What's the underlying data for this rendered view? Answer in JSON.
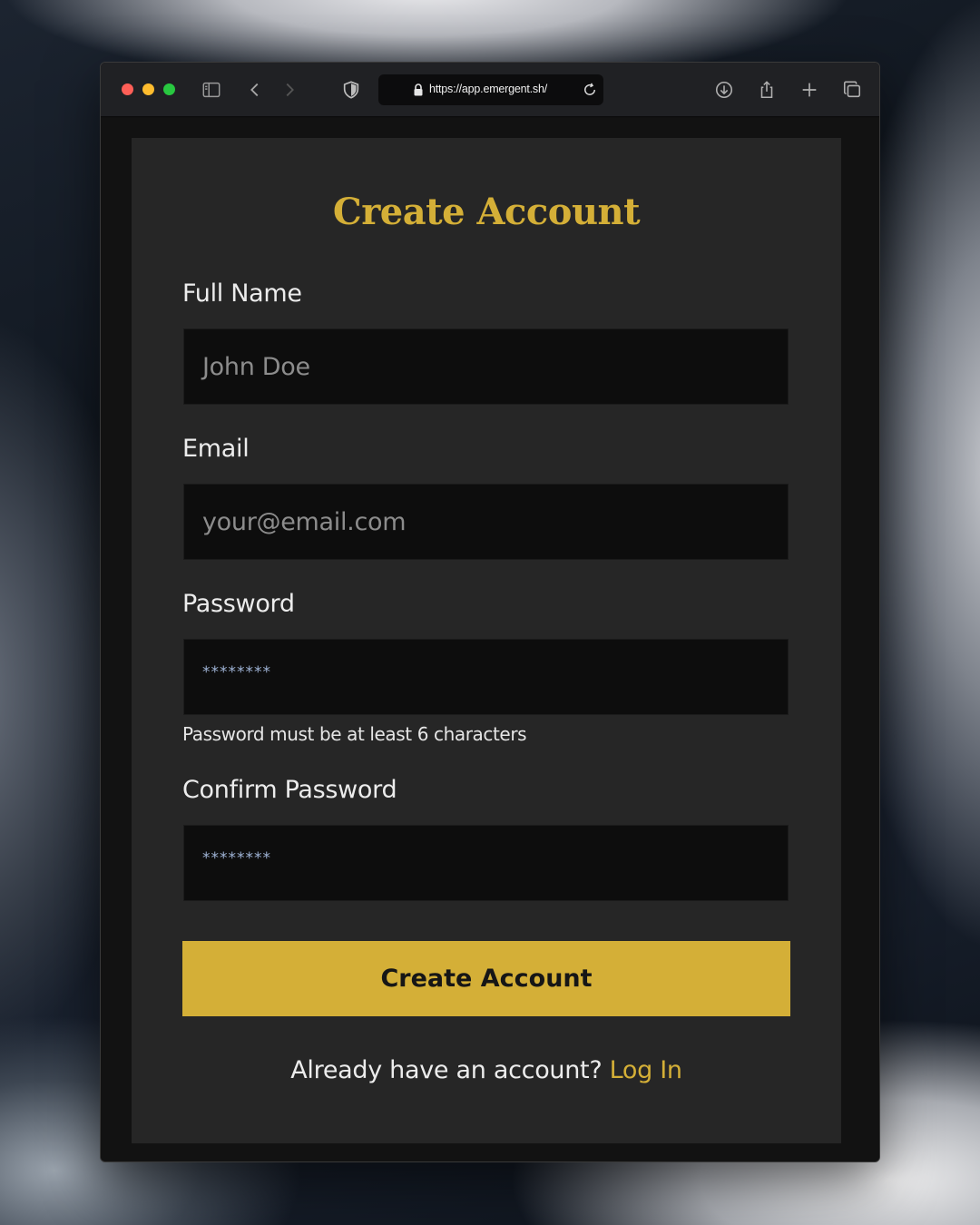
{
  "browser": {
    "url": "https://app.emergent.sh/",
    "icons": [
      "sidebar-icon",
      "back-icon",
      "forward-icon",
      "shield-icon",
      "lock-icon",
      "reload-icon",
      "download-icon",
      "share-icon",
      "new-tab-icon",
      "tabs-overview-icon"
    ]
  },
  "form": {
    "title": "Create Account",
    "fields": {
      "full_name": {
        "label": "Full Name",
        "placeholder": "John Doe"
      },
      "email": {
        "label": "Email",
        "placeholder": "your@email.com"
      },
      "password": {
        "label": "Password",
        "value": "********",
        "hint": "Password must be at least 6 characters"
      },
      "confirm_password": {
        "label": "Confirm Password",
        "value": "********"
      }
    },
    "submit_label": "Create Account",
    "footer_text": "Already have an account?",
    "login_link": "Log In"
  },
  "colors": {
    "accent": "#d4af37",
    "card": "#262626",
    "input": "#0d0d0d"
  }
}
